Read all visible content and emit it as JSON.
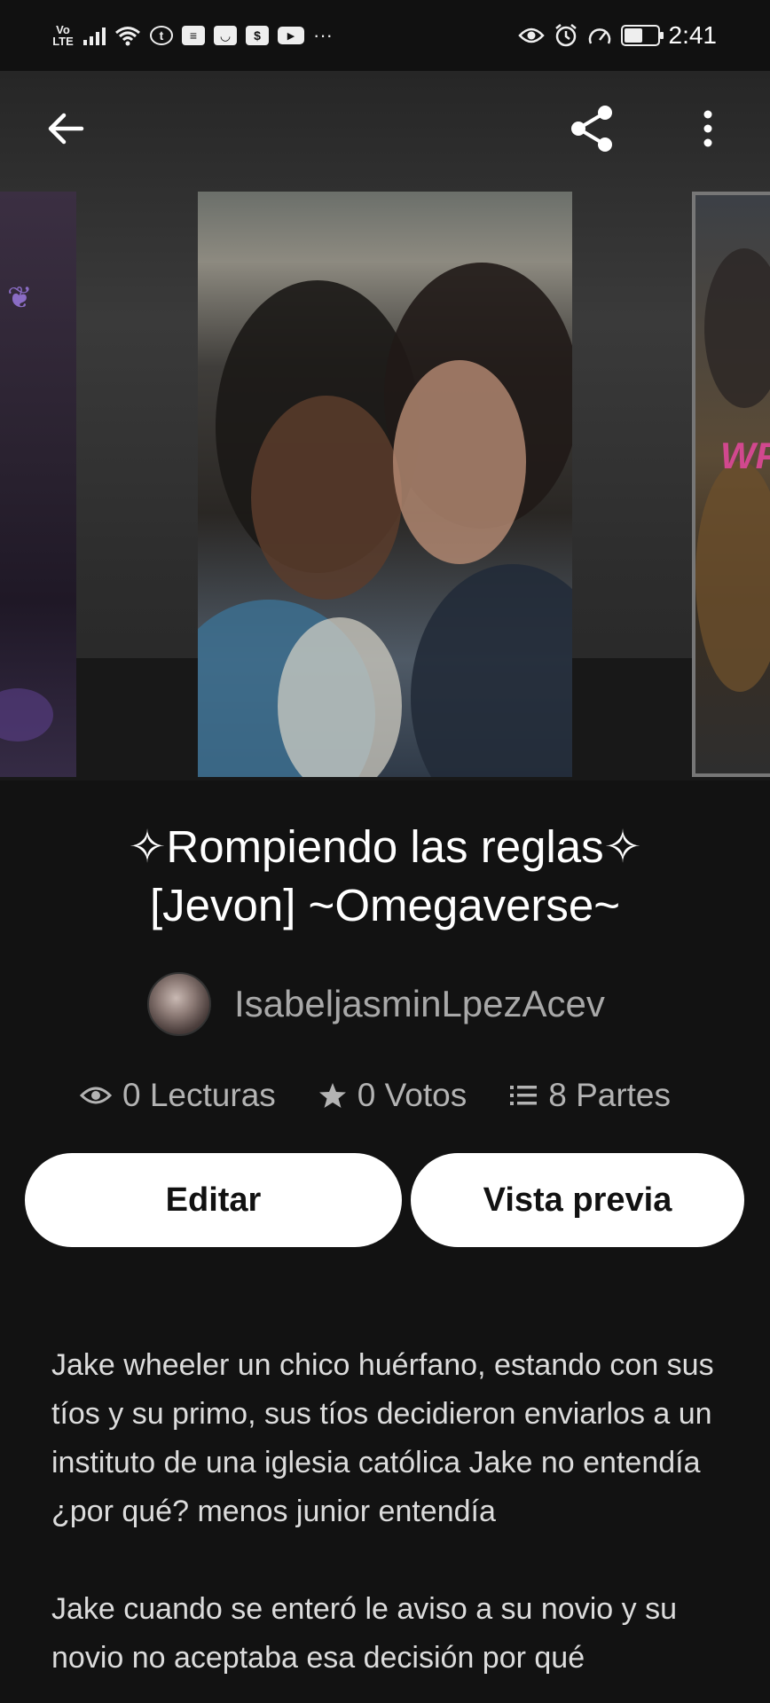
{
  "status_bar": {
    "network_label": "Vo LTE",
    "time": "2:41",
    "more": "···"
  },
  "toolbar": {
    "back_icon": "back-arrow-icon",
    "share_icon": "share-icon",
    "more_icon": "more-vert-icon"
  },
  "story": {
    "title_line1": "✧Rompiendo las reglas✧",
    "title_line2": "[Jevon] ~Omegaverse~",
    "author": "IsabeljasminLpezAcev",
    "stats": {
      "reads": "0 Lecturas",
      "votes": "0 Votos",
      "parts": "8 Partes"
    },
    "cover_text_right": "WP",
    "description": [
      "Jake wheeler un chico huérfano, estando con sus tíos y su primo, sus tíos decidieron enviarlos a un instituto de una iglesia católica Jake no entendía ¿por qué? menos junior entendía",
      "Jake cuando se enteró le aviso a su novio y su novio no aceptaba esa decisión por qué"
    ]
  },
  "actions": {
    "edit_label": "Editar",
    "preview_label": "Vista previa"
  }
}
